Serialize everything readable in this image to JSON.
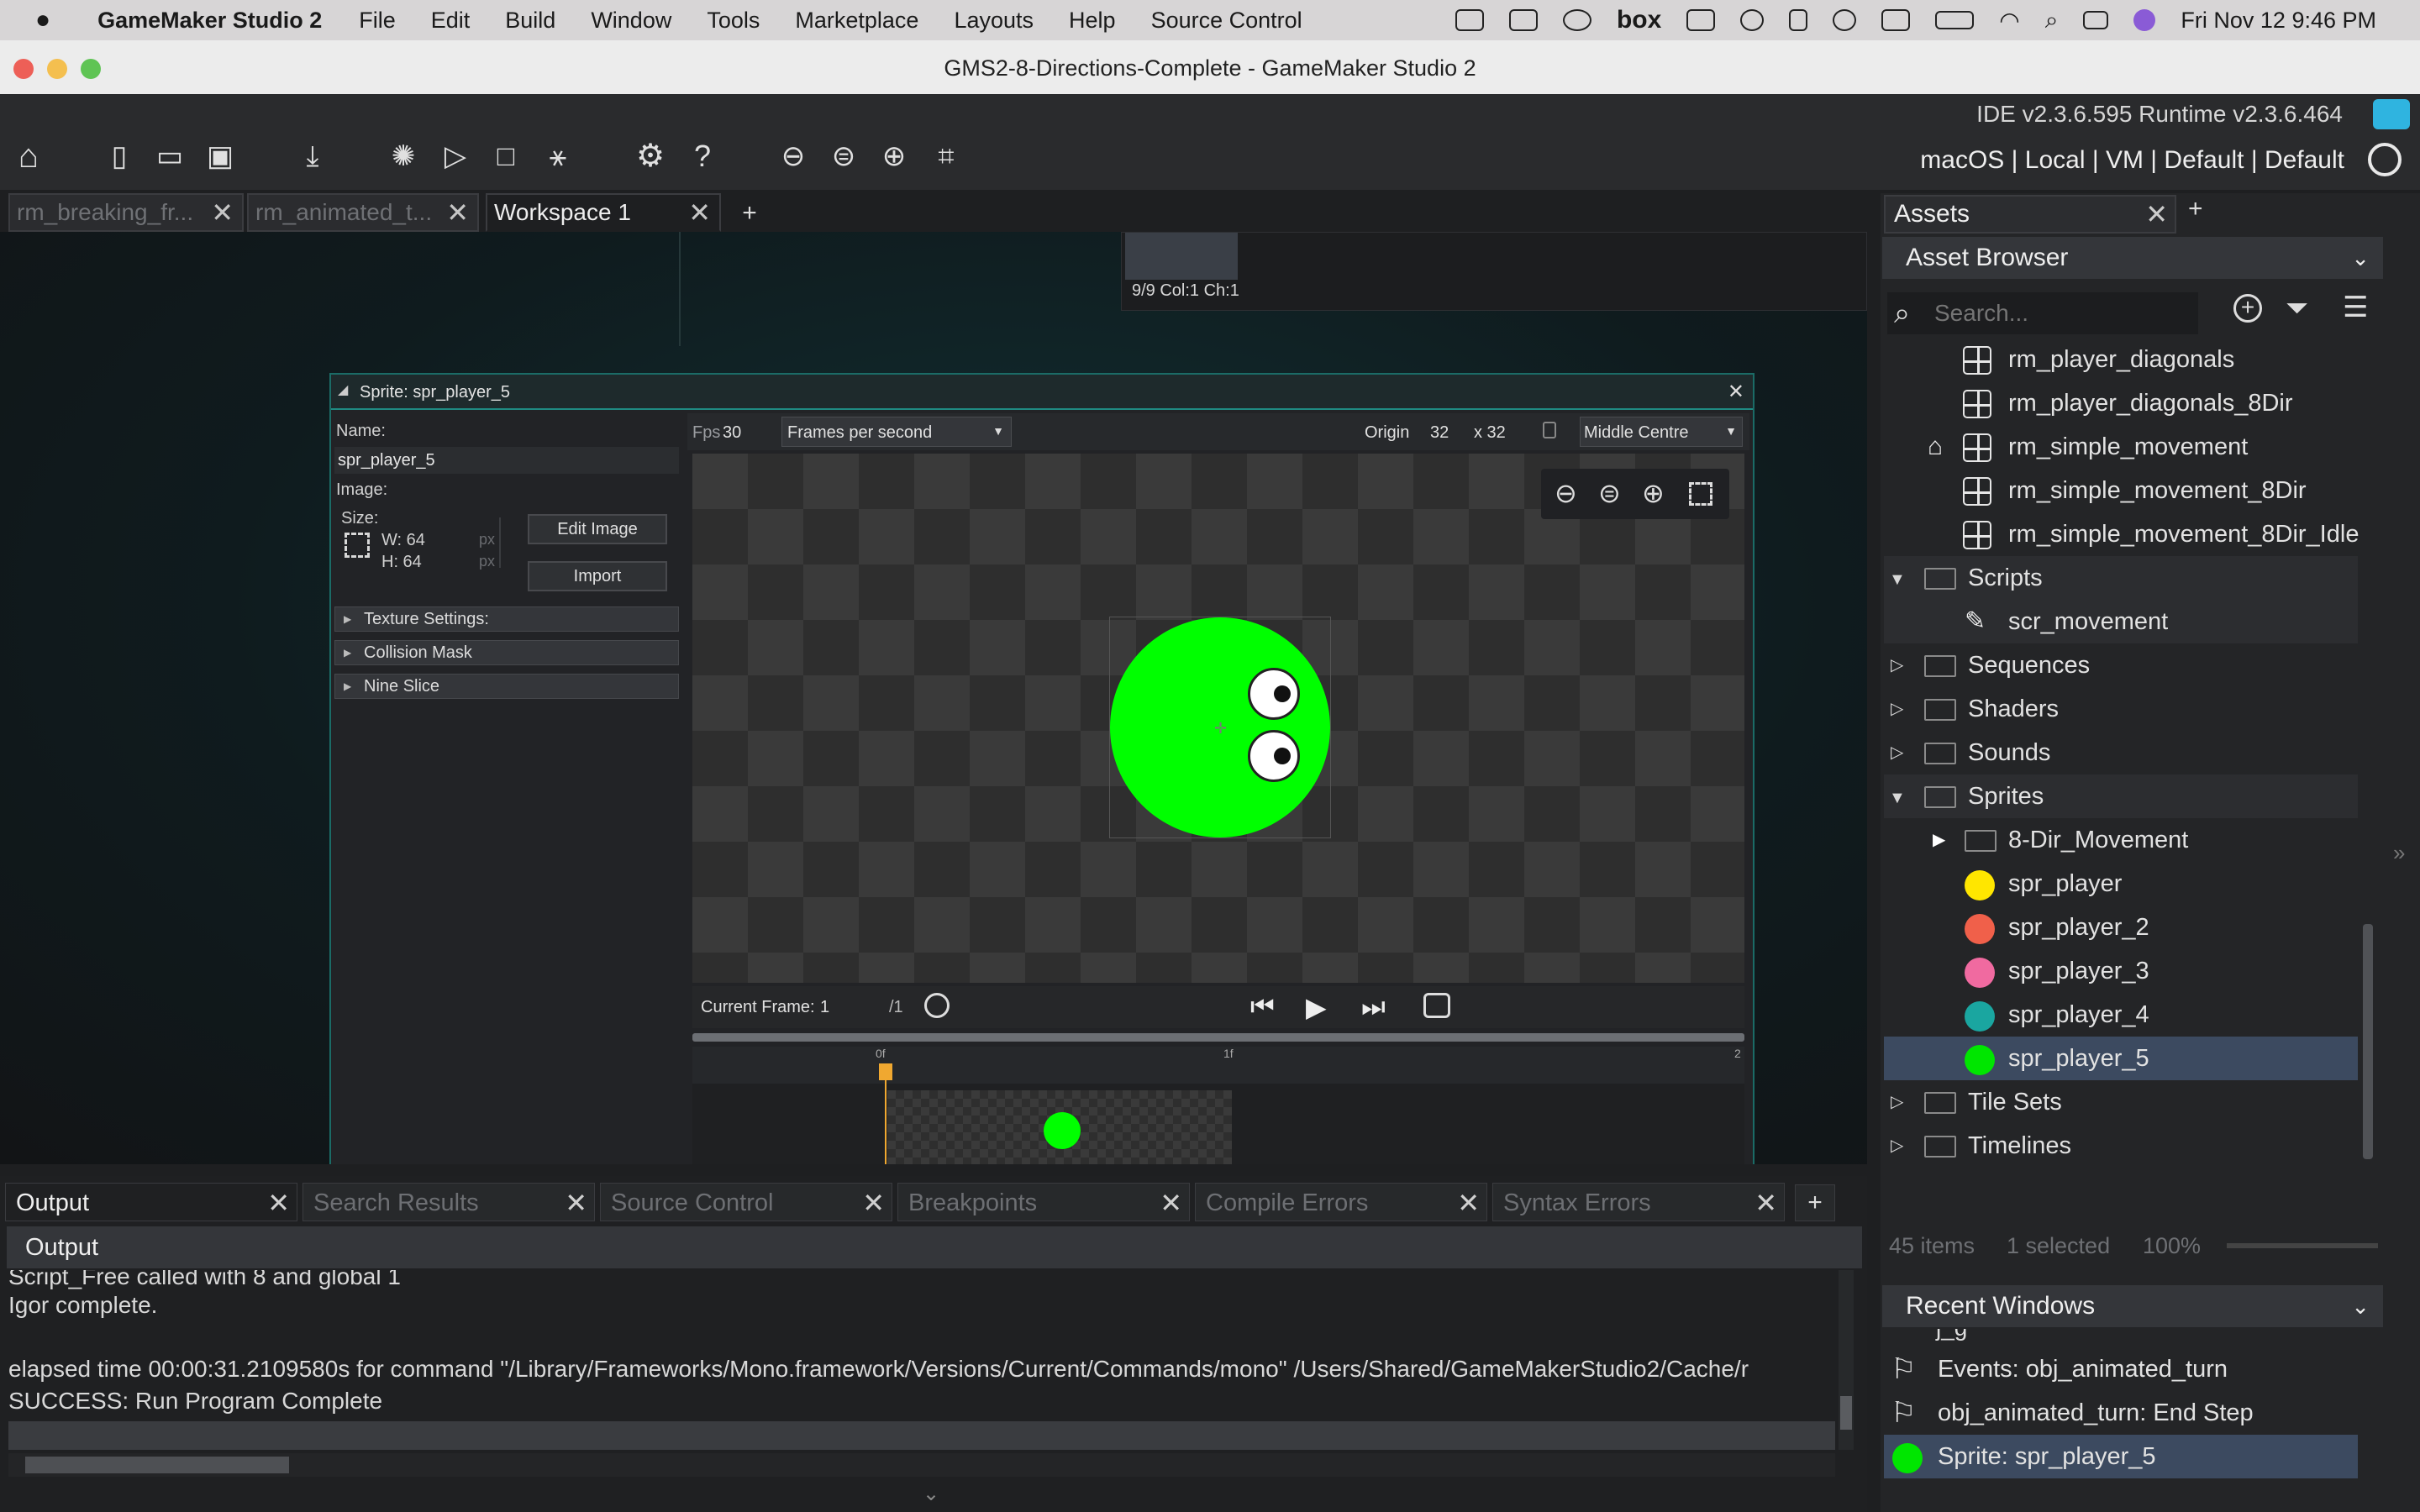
{
  "menubar": {
    "app_name": "GameMaker Studio 2",
    "items": [
      "File",
      "Edit",
      "Build",
      "Window",
      "Tools",
      "Marketplace",
      "Layouts",
      "Help",
      "Source Control"
    ],
    "box_label": "box",
    "clock": "Fri Nov 12  9:46 PM"
  },
  "window": {
    "title": "GMS2-8-Directions-Complete - GameMaker Studio 2"
  },
  "ide": {
    "version": "IDE v2.3.6.595  Runtime v2.3.6.464",
    "target": "macOS | Local | VM | Default | Default"
  },
  "tabs": [
    {
      "label": "rm_breaking_fr..."
    },
    {
      "label": "rm_animated_t..."
    },
    {
      "label": "Workspace 1"
    }
  ],
  "code_status": "9/9 Col:1 Ch:1",
  "sprite_editor": {
    "title": "Sprite: spr_player_5",
    "name_label": "Name:",
    "name_value": "spr_player_5",
    "image_label": "Image:",
    "size_label": "Size:",
    "width": "W: 64",
    "height": "H: 64",
    "unit": "px",
    "edit_image": "Edit Image",
    "import": "Import",
    "sections": [
      "Texture Settings:",
      "Collision Mask",
      "Nine Slice"
    ],
    "fps_label": "Fps",
    "fps_value": "30",
    "fps_mode": "Frames per second",
    "origin_label": "Origin",
    "origin_x": "32",
    "origin_y": "x 32",
    "origin_preset": "Middle Centre",
    "current_frame_label": "Current Frame:",
    "current_frame": "1",
    "frame_total": "/1",
    "timeline_start": "0f",
    "timeline_mid": "1f",
    "timeline_end": "2",
    "sprite_color": "#00ff00"
  },
  "assets": {
    "tab_label": "Assets",
    "browser_label": "Asset Browser",
    "search_placeholder": "Search...",
    "rows": [
      {
        "label": "rm_player_diagonals"
      },
      {
        "label": "rm_player_diagonals_8Dir"
      },
      {
        "label": "rm_simple_movement"
      },
      {
        "label": "rm_simple_movement_8Dir"
      },
      {
        "label": "rm_simple_movement_8Dir_Idle"
      },
      {
        "label": "Scripts"
      },
      {
        "label": "scr_movement"
      },
      {
        "label": "Sequences"
      },
      {
        "label": "Shaders"
      },
      {
        "label": "Sounds"
      },
      {
        "label": "Sprites"
      },
      {
        "label": "8-Dir_Movement"
      },
      {
        "label": "spr_player",
        "color": "#ffe600"
      },
      {
        "label": "spr_player_2",
        "color": "#f0604a"
      },
      {
        "label": "spr_player_3",
        "color": "#f06aa0"
      },
      {
        "label": "spr_player_4",
        "color": "#1aa6a0"
      },
      {
        "label": "spr_player_5",
        "color": "#00e600"
      },
      {
        "label": "Tile Sets"
      },
      {
        "label": "Timelines"
      }
    ],
    "items_count": "45 items",
    "selected_count": "1 selected",
    "zoom": "100%",
    "recent_label": "Recent Windows",
    "recent_partial": "j_g",
    "recent": [
      {
        "label": "Events: obj_animated_turn"
      },
      {
        "label": "obj_animated_turn: End Step"
      },
      {
        "label": "Sprite: spr_player_5"
      }
    ]
  },
  "output": {
    "tabs": [
      "Output",
      "Search Results",
      "Source Control",
      "Breakpoints",
      "Compile Errors",
      "Syntax Errors"
    ],
    "header": "Output",
    "lines": [
      "Script_Free called with 8 and global 1",
      "Igor complete.",
      "",
      "elapsed time 00:00:31.2109580s for command \"/Library/Frameworks/Mono.framework/Versions/Current/Commands/mono\" /Users/Shared/GameMakerStudio2/Cache/r",
      "SUCCESS: Run Program Complete"
    ]
  }
}
